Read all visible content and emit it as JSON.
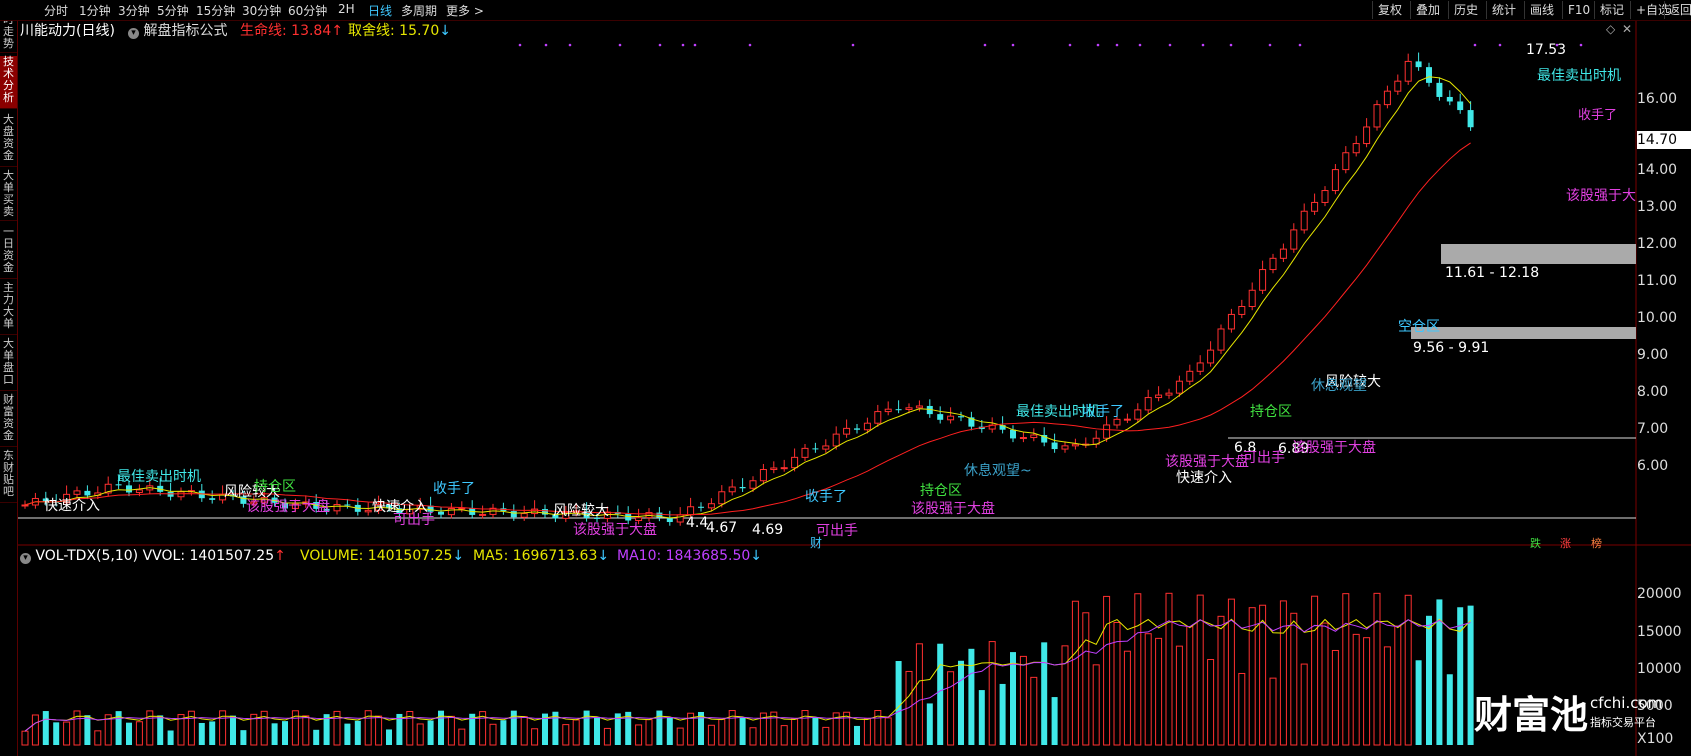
{
  "sidebar": {
    "tabs": [
      "分时走势",
      "技术分析",
      "大盘资金",
      "大单买卖",
      "一日资金",
      "主力大单",
      "大单盘口",
      "财富资金",
      "东财贴吧"
    ],
    "active": "技术分析"
  },
  "toolbar": {
    "timeframes": [
      "分时",
      "1分钟",
      "3分钟",
      "5分钟",
      "15分钟",
      "30分钟",
      "60分钟",
      "2H",
      "日线",
      "多周期",
      "更多"
    ],
    "active": "日线",
    "more_arrow": ">",
    "right_tools": [
      "复权",
      "叠加",
      "历史",
      "统计",
      "画线",
      "F10",
      "标记",
      "+自选",
      "返回"
    ]
  },
  "header": {
    "stock": "川能动力(日线)",
    "indicator": "解盘指标公式",
    "life_line": "生命线: 13.84",
    "life_arrow": "↑",
    "sell_line": "取舍线: 15.70",
    "sell_arrow": "↓"
  },
  "price_axis": {
    "ticks": [
      "16.00",
      "15.00",
      "14.00",
      "13.00",
      "12.00",
      "11.00",
      "10.00",
      "9.00",
      "8.00",
      "7.00",
      "6.00"
    ],
    "current": "14.70"
  },
  "markers": {
    "high": "17.53",
    "zone_upper": "11.61 - 12.18",
    "zone_lower": "9.56 - 9.91",
    "low_a": "4.67",
    "low_b": "4.69",
    "low_c": "4.4",
    "mid_a": "6.8",
    "mid_b": "6.89",
    "fin": "财"
  },
  "annotations": [
    "最佳卖出时机",
    "该股强于大",
    "收手了",
    "快速介入",
    "风险较大",
    "该股强于大盘",
    "持仓区",
    "可出手",
    "休息观望~",
    "空仓区",
    "最佳卖出时机",
    "收手了",
    "风险较大",
    "快速介入",
    "持仓区",
    "该股强于大盘",
    "快速介入",
    "风险较大",
    "可出手",
    "该股强于大盘",
    "收手了",
    "持仓区",
    "收手了",
    "可出手",
    "该股强于大盘",
    "休息观望",
    "最佳卖出时机",
    "该股强于大盘"
  ],
  "legend_tags": [
    "跌",
    "涨",
    "榜"
  ],
  "volume": {
    "title": "VOL-TDX(5,10) VVOL: 1401507.25",
    "title_arrow": "↑",
    "volume": "VOLUME: 1401507.25",
    "volume_arrow": "↓",
    "ma5": "MA5: 1696713.63",
    "ma5_arrow": "↓",
    "ma10": "MA10: 1843685.50",
    "ma10_arrow": "↓",
    "ticks": [
      "20000",
      "15000",
      "10000",
      "5000"
    ],
    "unit": "X100"
  },
  "watermark": {
    "text": "财富池",
    "domain": "cfchi.com",
    "sub": "指标交易平台"
  },
  "colors": {
    "up": "#ff3030",
    "down": "#40e8e8",
    "ma_yellow": "#e6e600",
    "ma_red": "#ff2020",
    "ma10_purple": "#c040ff",
    "accent_blue": "#3ec8ff"
  }
}
